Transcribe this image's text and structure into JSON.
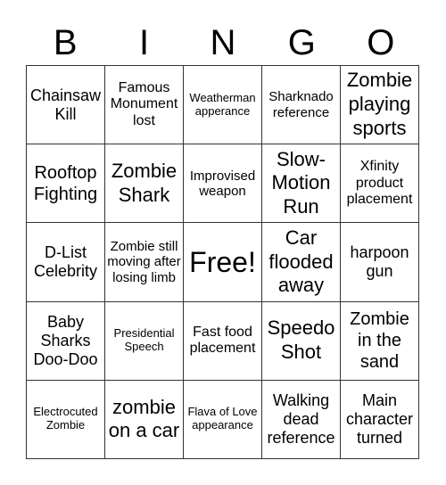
{
  "header": [
    "B",
    "I",
    "N",
    "G",
    "O"
  ],
  "cells": [
    {
      "text": "Chainsaw Kill",
      "size": "s18"
    },
    {
      "text": "Famous Monument lost",
      "size": "s16"
    },
    {
      "text": "Weatherman apperance",
      "size": "s13"
    },
    {
      "text": "Sharknado reference",
      "size": "s15"
    },
    {
      "text": "Zombie playing sports",
      "size": "s22"
    },
    {
      "text": "Rooftop Fighting",
      "size": "s20"
    },
    {
      "text": "Zombie Shark",
      "size": "s22"
    },
    {
      "text": "Improvised weapon",
      "size": "s15"
    },
    {
      "text": "Slow-Motion Run",
      "size": "s22"
    },
    {
      "text": "Xfinity product placement",
      "size": "s16"
    },
    {
      "text": "D-List Celebrity",
      "size": "s18"
    },
    {
      "text": "Zombie still moving after losing limb",
      "size": "s15"
    },
    {
      "text": "Free!",
      "size": "s32"
    },
    {
      "text": "Car flooded away",
      "size": "s22"
    },
    {
      "text": "harpoon gun",
      "size": "s18"
    },
    {
      "text": "Baby Sharks Doo-Doo",
      "size": "s18"
    },
    {
      "text": "Presidential Speech",
      "size": "s13"
    },
    {
      "text": "Fast food placement",
      "size": "s16"
    },
    {
      "text": "Speedo Shot",
      "size": "s22"
    },
    {
      "text": "Zombie in the sand",
      "size": "s20"
    },
    {
      "text": "Electrocuted Zombie",
      "size": "s13"
    },
    {
      "text": "zombie on a car",
      "size": "s22"
    },
    {
      "text": "Flava of Love appearance",
      "size": "s13"
    },
    {
      "text": "Walking dead reference",
      "size": "s18"
    },
    {
      "text": "Main character turned",
      "size": "s18"
    }
  ]
}
